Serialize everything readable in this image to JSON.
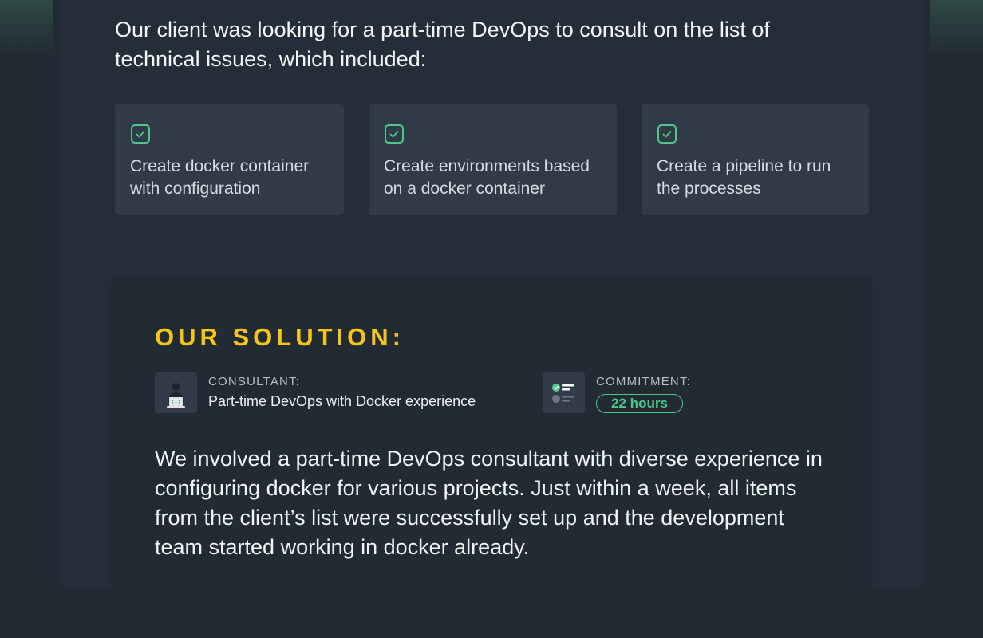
{
  "intro": {
    "text": "Our client was looking for a part-time DevOps to consult on the list of technical issues, which included:"
  },
  "tasks": [
    {
      "icon": "checkbox-checked-icon",
      "text": "Create docker container with configuration"
    },
    {
      "icon": "checkbox-checked-icon",
      "text": "Create environments based on a docker container"
    },
    {
      "icon": "checkbox-checked-icon",
      "text": "Create a pipeline to run the processes"
    }
  ],
  "solution": {
    "title": "OUR SOLUTION:",
    "consultant": {
      "icon": "consultant-avatar-icon",
      "label": "CONSULTANT:",
      "value": "Part-time DevOps with Docker experience"
    },
    "commitment": {
      "icon": "checklist-icon",
      "label": "COMMITMENT:",
      "value": "22 hours"
    },
    "text": "We involved a part-time DevOps consultant with diverse experience in configuring docker for various projects. Just within a week, all items from the client’s list were successfully set up and the development team started working in docker already."
  },
  "colors": {
    "page_background": "#222a33",
    "card_background": "#252e38",
    "task_card_background": "#313b47",
    "accent_yellow": "#f5c518",
    "accent_green": "#4cc98a",
    "text_primary": "#f2f4f6"
  }
}
